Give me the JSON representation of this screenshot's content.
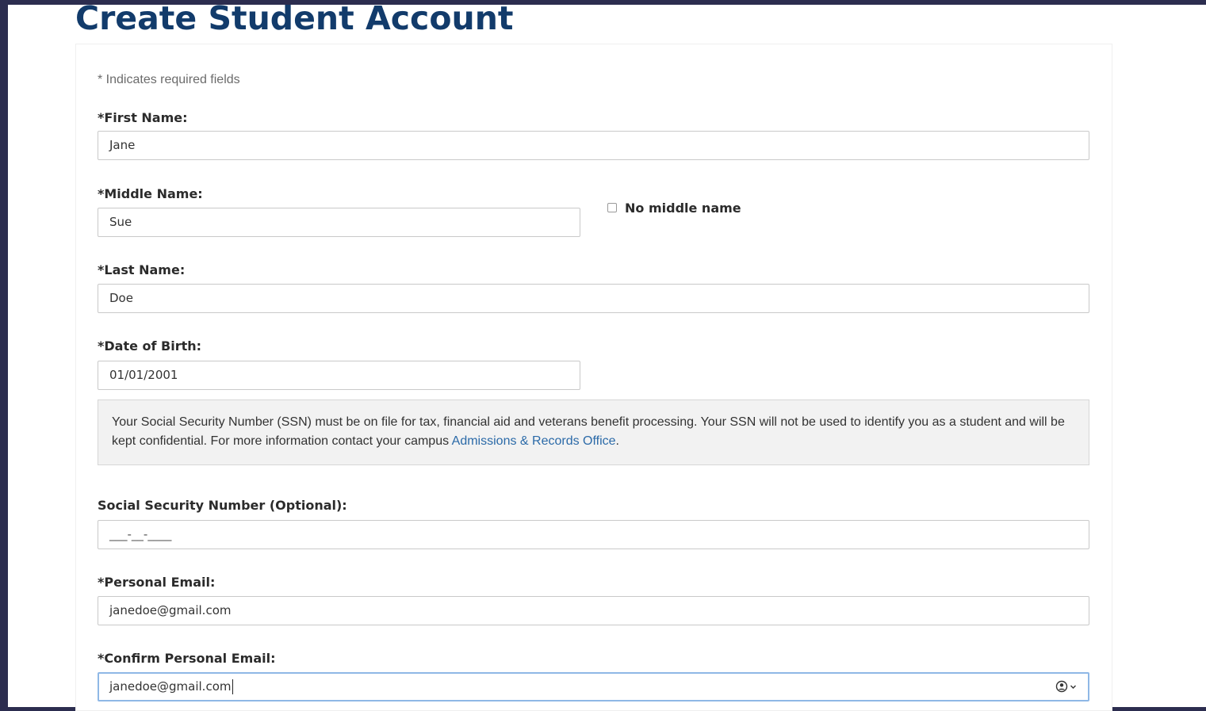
{
  "page": {
    "title": "Create Student Account",
    "required_note": "* Indicates required fields"
  },
  "form": {
    "first_name": {
      "label": "*First Name:",
      "value": "Jane"
    },
    "middle_name": {
      "label": "*Middle Name:",
      "value": "Sue",
      "no_middle_label": "No middle name",
      "no_middle_checked": false
    },
    "last_name": {
      "label": "*Last Name:",
      "value": "Doe"
    },
    "dob": {
      "label": "*Date of Birth:",
      "value": "01/01/2001"
    },
    "ssn_info": {
      "text": "Your Social Security Number (SSN) must be on file for tax, financial aid and veterans benefit processing. Your SSN will not be used to identify you as a student and will be kept confidential. For more information contact your campus ",
      "link": "Admissions & Records Office",
      "suffix": "."
    },
    "ssn": {
      "label": "Social Security Number (Optional):",
      "value": "___-__-____"
    },
    "email": {
      "label": "*Personal Email:",
      "value": "janedoe@gmail.com"
    },
    "confirm_email": {
      "label": "*Confirm Personal Email:",
      "value": "janedoe@gmail.com"
    }
  },
  "icons": {
    "autofill": "contact-autofill-icon",
    "chevron": "chevron-down-icon"
  },
  "colors": {
    "title": "#123b6b",
    "link": "#2b6aa8",
    "focus_border": "#8fb8e6",
    "frame": "#2c2d4f"
  }
}
